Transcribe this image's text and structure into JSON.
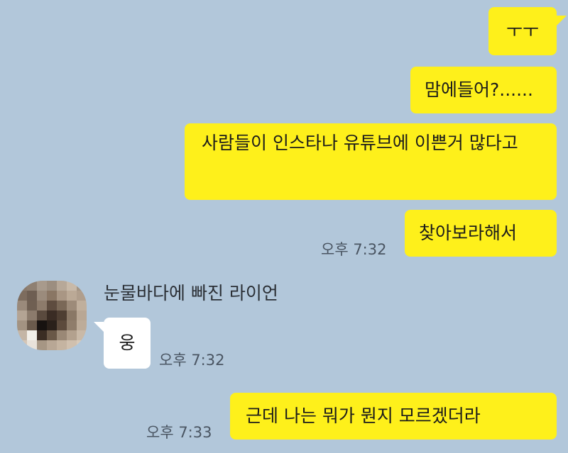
{
  "messages": {
    "m1": "ㅜㅜ",
    "m2": "맘에들어?......",
    "m3": "사람들이 인스타나 유튜브에 이쁜거 많다고",
    "m4": "찾아보라해서",
    "m5": "웅",
    "m6": "근데 나는 뭐가 뭔지 모르겠더라"
  },
  "times": {
    "t1": "오후 7:32",
    "t2": "오후 7:32",
    "t3": "오후 7:33"
  },
  "sender": {
    "name": "눈물바다에 빠진 라이언"
  },
  "colors": {
    "background": "#b2c7da",
    "my_bubble": "#fef01b",
    "other_bubble": "#ffffff"
  }
}
